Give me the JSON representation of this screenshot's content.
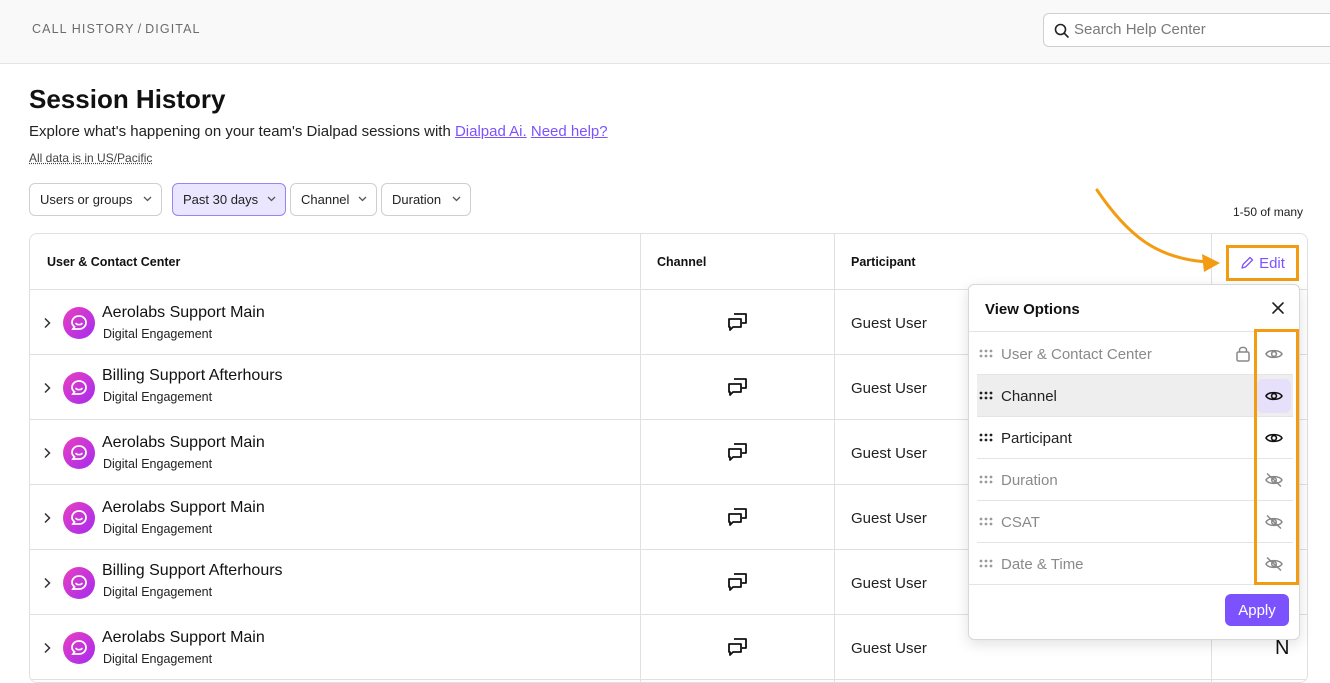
{
  "breadcrumb": {
    "parent": "CALL HISTORY",
    "separator": "/",
    "current": "DIGITAL"
  },
  "search": {
    "placeholder": "Search Help Center"
  },
  "page": {
    "title": "Session History",
    "subtitle_prefix": "Explore what's happening on your team's Dialpad sessions with ",
    "link_ai": "Dialpad Ai.",
    "link_help": "Need help?",
    "timezone_note": "All data is in US/Pacific"
  },
  "filters": [
    {
      "label": "Users or groups",
      "active": false
    },
    {
      "label": "Past 30 days",
      "active": true
    },
    {
      "label": "Channel",
      "active": false
    },
    {
      "label": "Duration",
      "active": false
    }
  ],
  "results_count": "1-50 of many",
  "table": {
    "headers": {
      "user": "User & Contact Center",
      "channel": "Channel",
      "participant": "Participant"
    },
    "edit_label": "Edit",
    "rows": [
      {
        "name": "Aerolabs Support Main",
        "sub": "Digital Engagement",
        "channel_icon": "chat-bubbles-icon",
        "participant": "Guest User"
      },
      {
        "name": "Billing Support Afterhours",
        "sub": "Digital Engagement",
        "channel_icon": "chat-bubbles-icon",
        "participant": "Guest User"
      },
      {
        "name": "Aerolabs Support Main",
        "sub": "Digital Engagement",
        "channel_icon": "chat-bubbles-icon",
        "participant": "Guest User"
      },
      {
        "name": "Aerolabs Support Main",
        "sub": "Digital Engagement",
        "channel_icon": "chat-bubbles-icon",
        "participant": "Guest User"
      },
      {
        "name": "Billing Support Afterhours",
        "sub": "Digital Engagement",
        "channel_icon": "chat-bubbles-icon",
        "participant": "Guest User"
      },
      {
        "name": "Aerolabs Support Main",
        "sub": "Digital Engagement",
        "channel_icon": "chat-bubbles-icon",
        "participant": "Guest User"
      }
    ],
    "partial_glyph": "N"
  },
  "view_options": {
    "title": "View Options",
    "options": [
      {
        "label": "User & Contact Center",
        "visible": true,
        "locked": true,
        "dim": true
      },
      {
        "label": "Channel",
        "visible": true,
        "locked": false,
        "dim": false,
        "highlight": true
      },
      {
        "label": "Participant",
        "visible": true,
        "locked": false,
        "dim": false
      },
      {
        "label": "Duration",
        "visible": false,
        "locked": false,
        "dim": true
      },
      {
        "label": "CSAT",
        "visible": false,
        "locked": false,
        "dim": true
      },
      {
        "label": "Date & Time",
        "visible": false,
        "locked": false,
        "dim": true
      }
    ],
    "apply_label": "Apply"
  },
  "colors": {
    "accent": "#7c52ff",
    "annotation": "#f39c12",
    "avatar_start": "#e93fbf",
    "avatar_end": "#a52cf0"
  }
}
